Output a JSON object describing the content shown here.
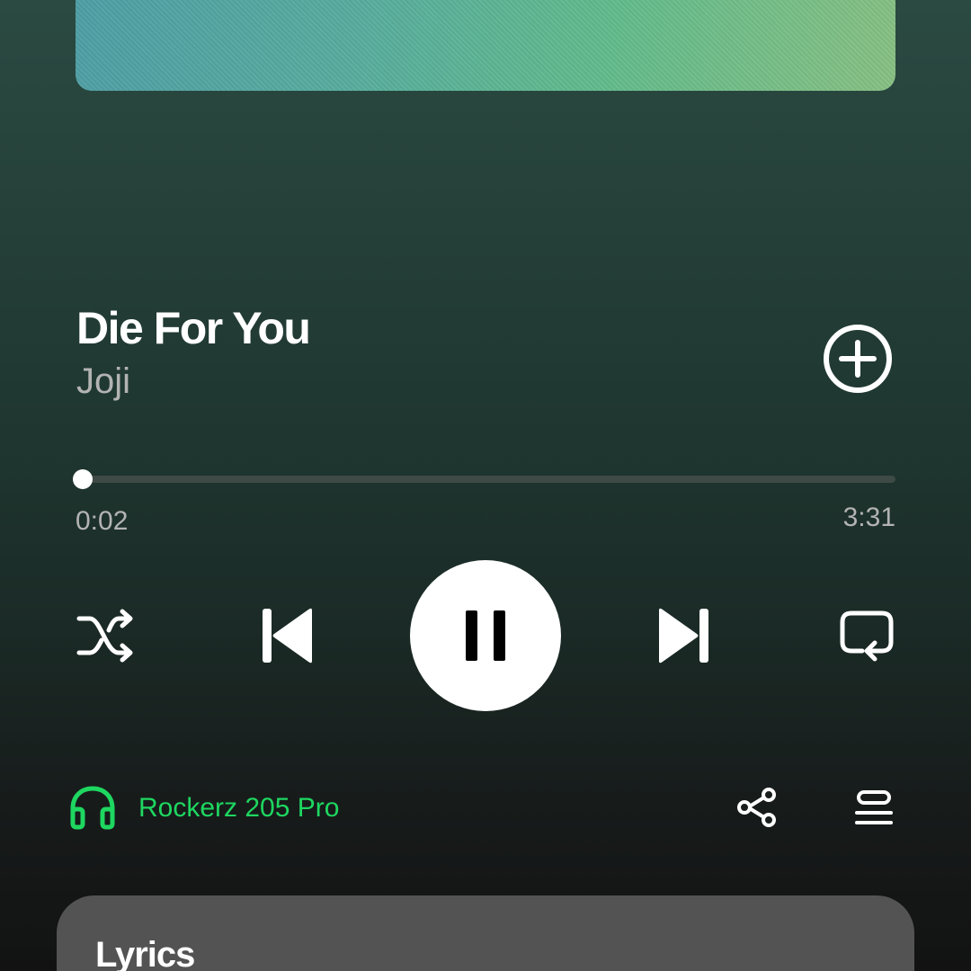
{
  "track": {
    "title": "Die For You",
    "artist": "Joji"
  },
  "playback": {
    "elapsed": "0:02",
    "duration": "3:31",
    "progress_fraction": 0.009,
    "state": "playing"
  },
  "controls": {
    "add_icon": "plus-circle-icon",
    "shuffle_icon": "shuffle-icon",
    "previous_icon": "skip-previous-icon",
    "pause_icon": "pause-icon",
    "next_icon": "skip-next-icon",
    "repeat_icon": "repeat-icon"
  },
  "device": {
    "icon": "headphones-icon",
    "label": "Rockerz 205 Pro",
    "color": "#1ed760"
  },
  "actions": {
    "share_icon": "share-icon",
    "queue_icon": "queue-icon"
  },
  "lyrics": {
    "title": "Lyrics"
  },
  "colors": {
    "accent": "#1ed760",
    "secondary_text": "#b3b3b3",
    "lyrics_card": "#535353"
  }
}
